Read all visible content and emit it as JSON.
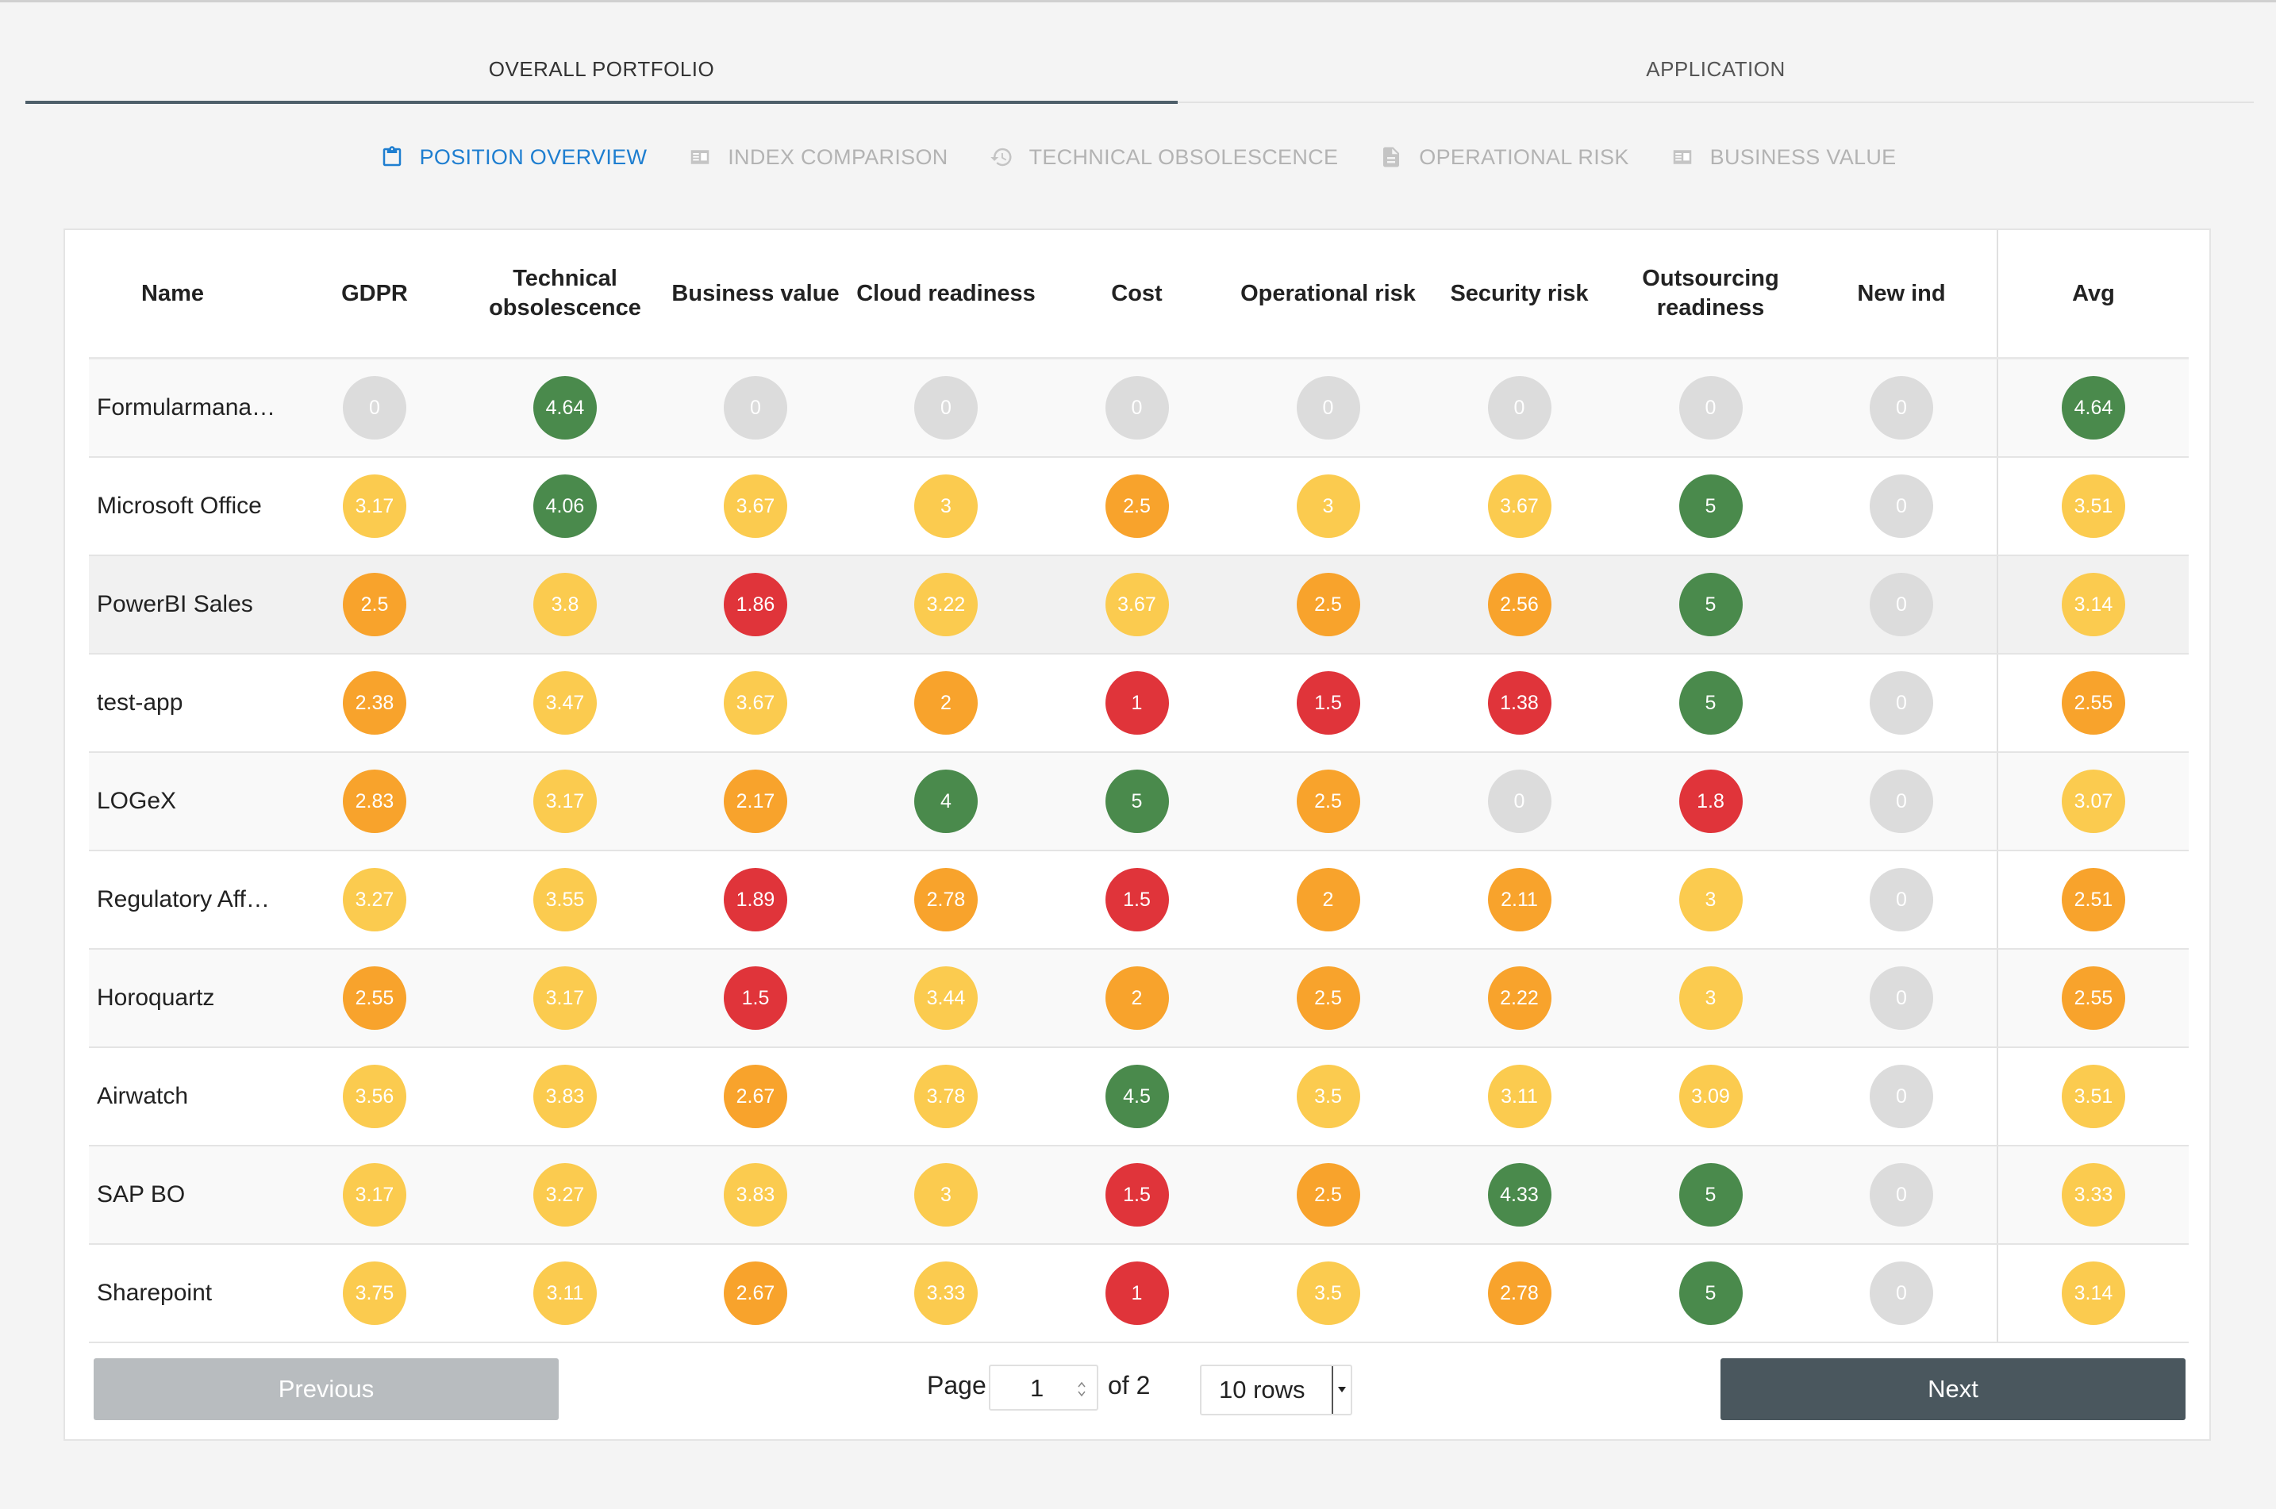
{
  "main_tabs": [
    {
      "label": "OVERALL PORTFOLIO",
      "active": true
    },
    {
      "label": "APPLICATION",
      "active": false
    }
  ],
  "sub_tabs": [
    {
      "label": "POSITION OVERVIEW",
      "icon": "clipboard-icon",
      "active": true
    },
    {
      "label": "INDEX COMPARISON",
      "icon": "card-icon",
      "active": false
    },
    {
      "label": "TECHNICAL OBSOLESCENCE",
      "icon": "history-icon",
      "active": false
    },
    {
      "label": "OPERATIONAL RISK",
      "icon": "document-icon",
      "active": false
    },
    {
      "label": "BUSINESS VALUE",
      "icon": "card-icon",
      "active": false
    }
  ],
  "table": {
    "columns": [
      "Name",
      "GDPR",
      "Technical obsolescence",
      "Business value",
      "Cloud readiness",
      "Cost",
      "Operational risk",
      "Security risk",
      "Outsourcing readiness",
      "New ind",
      "Avg"
    ],
    "rows": [
      {
        "name": "Formularmana…",
        "values": [
          "0",
          "4.64",
          "0",
          "0",
          "0",
          "0",
          "0",
          "0",
          "0",
          "4.64"
        ],
        "colors": [
          "gray",
          "green",
          "gray",
          "gray",
          "gray",
          "gray",
          "gray",
          "gray",
          "gray",
          "green"
        ]
      },
      {
        "name": "Microsoft Office",
        "values": [
          "3.17",
          "4.06",
          "3.67",
          "3",
          "2.5",
          "3",
          "3.67",
          "5",
          "0",
          "3.51"
        ],
        "colors": [
          "yellow",
          "green",
          "yellow",
          "yellow",
          "orange",
          "yellow",
          "yellow",
          "green",
          "gray",
          "yellow"
        ]
      },
      {
        "name": "PowerBI Sales",
        "values": [
          "2.5",
          "3.8",
          "1.86",
          "3.22",
          "3.67",
          "2.5",
          "2.56",
          "5",
          "0",
          "3.14"
        ],
        "colors": [
          "orange",
          "yellow",
          "red",
          "yellow",
          "yellow",
          "orange",
          "orange",
          "green",
          "gray",
          "yellow"
        ]
      },
      {
        "name": "test-app",
        "values": [
          "2.38",
          "3.47",
          "3.67",
          "2",
          "1",
          "1.5",
          "1.38",
          "5",
          "0",
          "2.55"
        ],
        "colors": [
          "orange",
          "yellow",
          "yellow",
          "orange",
          "red",
          "red",
          "red",
          "green",
          "gray",
          "orange"
        ]
      },
      {
        "name": "LOGeX",
        "values": [
          "2.83",
          "3.17",
          "2.17",
          "4",
          "5",
          "2.5",
          "0",
          "1.8",
          "0",
          "3.07"
        ],
        "colors": [
          "orange",
          "yellow",
          "orange",
          "green",
          "green",
          "orange",
          "gray",
          "red",
          "gray",
          "yellow"
        ]
      },
      {
        "name": "Regulatory Aff…",
        "values": [
          "3.27",
          "3.55",
          "1.89",
          "2.78",
          "1.5",
          "2",
          "2.11",
          "3",
          "0",
          "2.51"
        ],
        "colors": [
          "yellow",
          "yellow",
          "red",
          "orange",
          "red",
          "orange",
          "orange",
          "yellow",
          "gray",
          "orange"
        ]
      },
      {
        "name": "Horoquartz",
        "values": [
          "2.55",
          "3.17",
          "1.5",
          "3.44",
          "2",
          "2.5",
          "2.22",
          "3",
          "0",
          "2.55"
        ],
        "colors": [
          "orange",
          "yellow",
          "red",
          "yellow",
          "orange",
          "orange",
          "orange",
          "yellow",
          "gray",
          "orange"
        ]
      },
      {
        "name": "Airwatch",
        "values": [
          "3.56",
          "3.83",
          "2.67",
          "3.78",
          "4.5",
          "3.5",
          "3.11",
          "3.09",
          "0",
          "3.51"
        ],
        "colors": [
          "yellow",
          "yellow",
          "orange",
          "yellow",
          "green",
          "yellow",
          "yellow",
          "yellow",
          "gray",
          "yellow"
        ]
      },
      {
        "name": "SAP BO",
        "values": [
          "3.17",
          "3.27",
          "3.83",
          "3",
          "1.5",
          "2.5",
          "4.33",
          "5",
          "0",
          "3.33"
        ],
        "colors": [
          "yellow",
          "yellow",
          "yellow",
          "yellow",
          "red",
          "orange",
          "green",
          "green",
          "gray",
          "yellow"
        ]
      },
      {
        "name": "Sharepoint",
        "values": [
          "3.75",
          "3.11",
          "2.67",
          "3.33",
          "1",
          "3.5",
          "2.78",
          "5",
          "0",
          "3.14"
        ],
        "colors": [
          "yellow",
          "yellow",
          "orange",
          "yellow",
          "red",
          "yellow",
          "orange",
          "green",
          "gray",
          "yellow"
        ]
      }
    ]
  },
  "pagination": {
    "previous_label": "Previous",
    "next_label": "Next",
    "page_label": "Page",
    "current_page": "1",
    "of_label": "of 2",
    "rows_option": "10 rows"
  },
  "colors": {
    "green": "#4a8a4c",
    "yellow": "#fbcb4f",
    "orange": "#f8a32c",
    "red": "#e0343a",
    "gray": "#dcdcdc",
    "accent": "#1e7ed0"
  }
}
